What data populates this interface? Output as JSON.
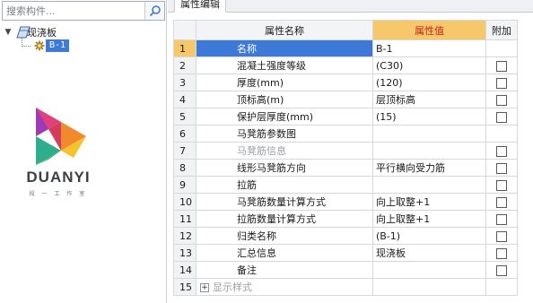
{
  "search": {
    "placeholder": "搜索构件..."
  },
  "tree": {
    "root": {
      "toggle": "▼",
      "label": "现浇板"
    },
    "child": {
      "label": "B-1"
    }
  },
  "logo": {
    "text": "DUANYI",
    "sub": "段 一 工 作 室"
  },
  "panel": {
    "tab_label": "属性编辑"
  },
  "table": {
    "headers": {
      "name": "属性名称",
      "value": "属性值",
      "extra": "附加"
    },
    "rows": [
      {
        "num": "1",
        "name": "名称",
        "value": "B-1",
        "checkbox": false
      },
      {
        "num": "2",
        "name": "混凝土强度等级",
        "value": "(C30)",
        "checkbox": true
      },
      {
        "num": "3",
        "name": "厚度(mm)",
        "value": "(120)",
        "checkbox": true
      },
      {
        "num": "4",
        "name": "顶标高(m)",
        "value": "层顶标高",
        "checkbox": true
      },
      {
        "num": "5",
        "name": "保护层厚度(mm)",
        "value": "(15)",
        "checkbox": true
      },
      {
        "num": "6",
        "name": "马凳筋参数图",
        "value": "",
        "checkbox": false
      },
      {
        "num": "7",
        "name": "马凳筋信息",
        "value": "",
        "checkbox": true
      },
      {
        "num": "8",
        "name": "线形马凳筋方向",
        "value": "平行横向受力筋",
        "checkbox": true
      },
      {
        "num": "9",
        "name": "拉筋",
        "value": "",
        "checkbox": true
      },
      {
        "num": "10",
        "name": "马凳筋数量计算方式",
        "value": "向上取整+1",
        "checkbox": true
      },
      {
        "num": "11",
        "name": "拉筋数量计算方式",
        "value": "向上取整+1",
        "checkbox": true
      },
      {
        "num": "12",
        "name": "归类名称",
        "value": "(B-1)",
        "checkbox": true
      },
      {
        "num": "13",
        "name": "汇总信息",
        "value": "现浇板",
        "checkbox": true
      },
      {
        "num": "14",
        "name": "备注",
        "value": "",
        "checkbox": true
      },
      {
        "num": "15",
        "name": "显示样式",
        "value": "",
        "checkbox": false,
        "expander": "+"
      }
    ]
  },
  "colors": {
    "selection": "#3d79d9",
    "header_highlight": "#f7c86a",
    "header_text_red": "#c62222"
  }
}
